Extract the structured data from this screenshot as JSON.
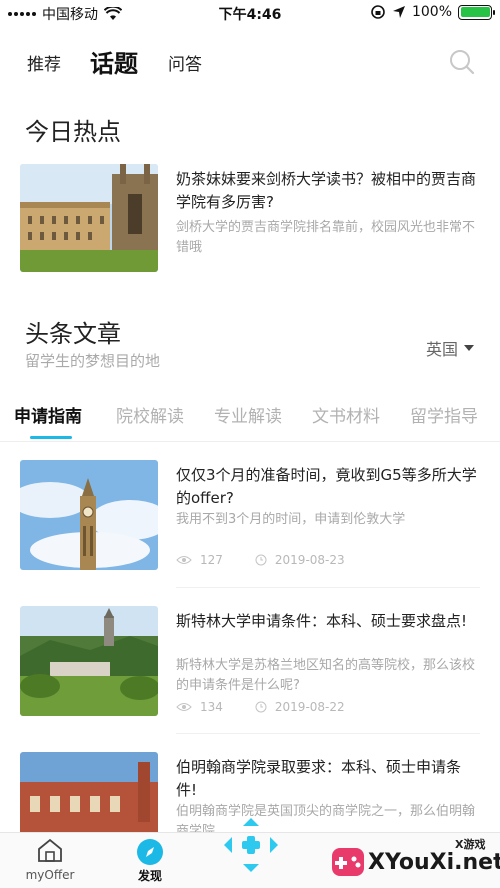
{
  "status": {
    "carrier": "中国移动",
    "time": "下午4:46",
    "battery": "100%"
  },
  "topnav": {
    "tabs": [
      "推荐",
      "话题",
      "问答"
    ],
    "active": "话题"
  },
  "hot": {
    "title": "今日热点",
    "item": {
      "title": "奶茶妹妹要来剑桥大学读书？被相中的贾吉商学院有多厉害?",
      "desc": "剑桥大学的贾吉商学院排名靠前，校园风光也非常不错哦"
    }
  },
  "headline": {
    "title": "头条文章",
    "subtitle": "留学生的梦想目的地",
    "country": "英国"
  },
  "category_tabs": [
    "申请指南",
    "院校解读",
    "专业解读",
    "文书材料",
    "留学指导"
  ],
  "articles": [
    {
      "title": "仅仅3个月的准备时间，竟收到G5等多所大学的offer?",
      "desc": "我用不到3个月的时间，申请到伦敦大学",
      "views": "127",
      "date": "2019-08-23"
    },
    {
      "title": " 斯特林大学申请条件：本科、硕士要求盘点!",
      "desc": "斯特林大学是苏格兰地区知名的高等院校，那么该校的申请条件是什么呢?",
      "views": "134",
      "date": "2019-08-22"
    },
    {
      "title": "伯明翰商学院录取要求：本科、硕士申请条件!",
      "desc": "伯明翰商学院是英国顶尖的商学院之一，那么伯明翰商学院",
      "views": "",
      "date": ""
    }
  ],
  "bottom_nav": [
    {
      "label": "myOffer",
      "icon": "home-icon"
    },
    {
      "label": "发现",
      "icon": "compass-icon"
    }
  ],
  "watermark": {
    "text": "XYouXi.net",
    "tag": "X游戏"
  },
  "colors": {
    "accent": "#1cb8e6",
    "battery": "#27c346"
  }
}
